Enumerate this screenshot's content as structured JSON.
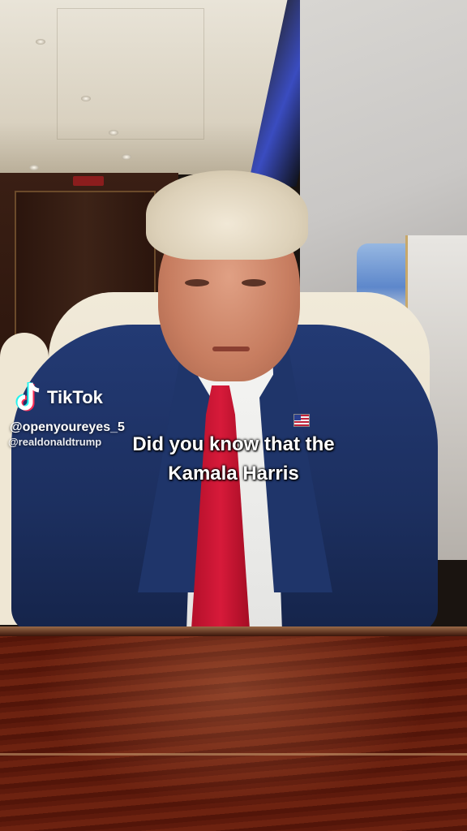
{
  "watermark": {
    "brand": "TikTok",
    "username": "@openyoureyes_5",
    "username_overlap": "@realdonaldtrump"
  },
  "caption": {
    "line1": "Did you know that the",
    "line2": "Kamala Harris"
  }
}
